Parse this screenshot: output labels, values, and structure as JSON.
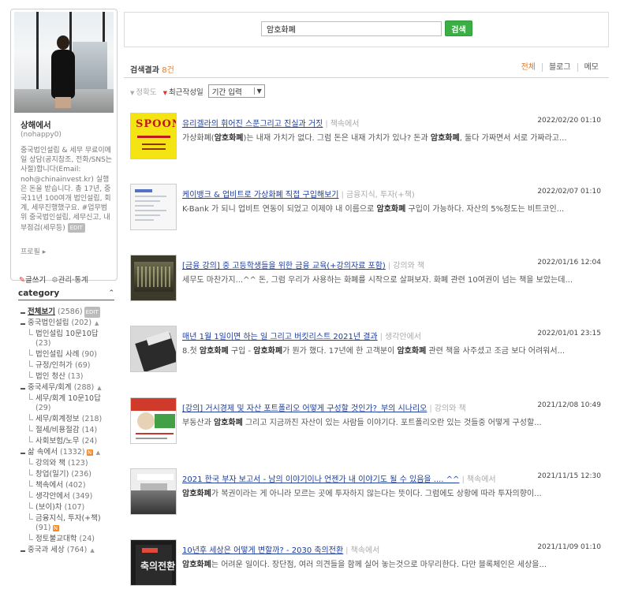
{
  "profile": {
    "blog_name": "상해에서",
    "blog_id": "(nohappy0)",
    "description": "중국법인설립 & 세무 무료이메일 상담(공지참조, 전화/SNS는 사절)합니다(Email: noh@chinainvest.kr) 실행은 돈을 받습니다.  총 17년, 중국11년 100여개 법인설립, 회계, 세무진행했구요.  #업무범위 중국법인설립, 세무신고, 내부점검(세무등)",
    "more_badge": "EDIT",
    "profile_link": "프로필",
    "write_label": "글쓰기",
    "manage_label": "관리·통계"
  },
  "category": {
    "title": "category",
    "toggle": "⌃",
    "items": [
      {
        "level": 0,
        "name": "전체보기",
        "count": "(2586)",
        "badge": "EDIT",
        "all": true
      },
      {
        "level": 0,
        "name": "중국법인설립",
        "count": "(202)",
        "caret": "▲"
      },
      {
        "level": 1,
        "name": "법인설립 10문10답",
        "count": "(23)",
        "multiline": true
      },
      {
        "level": 1,
        "name": "법인설립 사례",
        "count": "(90)"
      },
      {
        "level": 1,
        "name": "규정/인허가",
        "count": "(69)"
      },
      {
        "level": 1,
        "name": "법인 청산",
        "count": "(13)"
      },
      {
        "level": 0,
        "name": "중국세무/회계",
        "count": "(288)",
        "caret": "▲"
      },
      {
        "level": 1,
        "name": "세무/회계 10문10답",
        "count": "(29)",
        "multiline": true
      },
      {
        "level": 1,
        "name": "세무/회계정보",
        "count": "(218)"
      },
      {
        "level": 1,
        "name": "절세/비용절감",
        "count": "(14)"
      },
      {
        "level": 1,
        "name": "사회보험/노무",
        "count": "(24)"
      },
      {
        "level": 0,
        "name": "삶 속에서",
        "count": "(1332)",
        "new": "N",
        "caret": "▲"
      },
      {
        "level": 1,
        "name": "강의와 책",
        "count": "(123)"
      },
      {
        "level": 1,
        "name": "창업(일기)",
        "count": "(236)"
      },
      {
        "level": 1,
        "name": "책속에서",
        "count": "(402)"
      },
      {
        "level": 1,
        "name": "생각안에서",
        "count": "(349)"
      },
      {
        "level": 1,
        "name": "(보이)차",
        "count": "(107)"
      },
      {
        "level": 1,
        "name": "금융지식, 투자(+책)",
        "count": "(91)",
        "new": "N",
        "multiline": true
      },
      {
        "level": 1,
        "name": "정토불교대학",
        "count": "(24)"
      },
      {
        "level": 0,
        "name": "중국과 세상",
        "count": "(764)",
        "caret": "▲"
      }
    ]
  },
  "search": {
    "query": "암호화폐",
    "button_label": "검색"
  },
  "results_header": {
    "label": "검색결과",
    "count": "8건",
    "tabs": [
      {
        "label": "전체",
        "active": true
      },
      {
        "label": "블로그",
        "active": false
      },
      {
        "label": "메모",
        "active": false
      }
    ]
  },
  "sort": {
    "accuracy": "정확도",
    "recent": "최근작성일",
    "period_value": "기간 입력"
  },
  "results": [
    {
      "title": "유리겔라의 휘어진 스푼그리고 진실과 거짓",
      "category": "책속에서",
      "date": "2022/02/20 01:10",
      "excerpt": "가상화폐(암호화폐)는 내재 가치가 없다. 그럼 돈은 내재 가치가 있나? 돈과 암호화폐, 둘다 가짜면서 서로 가짜라고...",
      "thumb": "spoon-book-cover",
      "thumb_text": "SPOON"
    },
    {
      "title": "케이뱅크 & 업비트로 가상화폐 직접 구입해보기",
      "category": "금융지식, 투자(+책)",
      "date": "2022/02/07 01:10",
      "excerpt": "K-Bank 가 되니 업비트 연동이 되었고 이제야 내 이름으로 암호화폐 구입이 가능하다. 자산의 5%정도는 비트코인...",
      "thumb": "app-screenshot"
    },
    {
      "title": "[금융 강의] 중 고등학생들을 위한 금융 교육(+강의자료 포함)",
      "category": "강의와 책",
      "date": "2022/01/16 12:04",
      "excerpt": "세무도 마찬가지...^^ 돈, 그럼 우리가 사용하는 화폐를 시작으로 살펴보자. 화폐 관련 10여권이 넘는 책을 보았는데...",
      "thumb": "lecture-screen"
    },
    {
      "title": "매년 1월 1일이면 하는 일 그리고 버킷리스트 2021년 결과",
      "category": "생각안에서",
      "date": "2022/01/01 23:15",
      "excerpt": "8.첫 암호화폐 구입 - 암호화폐가 뭔가 했다. 17년에 한 고객분이 암호화폐 관련 책을 사주셨고 조금 보다 어려워서...",
      "thumb": "book-photo"
    },
    {
      "title": "[강의] 거시경제 및 자산 포트폴리오 어떻게 구성할 것인가?_부의 시나리오",
      "category": "강의와 책",
      "date": "2021/12/08 10:49",
      "excerpt": "부동산과 암호화폐 그리고 지금까진 자산이 있는 사람들 이야기다. 포트폴리오란 있는 것들중 어떻게 구성할...",
      "thumb": "lecture-poster"
    },
    {
      "title": "2021 한국 부자 보고서 - 남의 이야기이나 언젠가 내 이야기도 될 수 있음을 .... ^^",
      "category": "책속에서",
      "date": "2021/11/15 12:30",
      "excerpt": "암호화폐가 복권이라는 게 아니라 모르는 곳에 투자하지 않는다는 뜻이다. 그럼에도 상황에 따라 투자의향이...",
      "thumb": "report-seminar"
    },
    {
      "title": "10년후 세상은 어떻게 변할까? - 2030 축의전환",
      "category": "책속에서",
      "date": "2021/11/09 01:10",
      "excerpt": "암호화폐는 어려운 일이다. 장단점, 여러 의견들을 함께 실어 놓는것으로 마무리한다. 다만 블록체인은 세상을...",
      "thumb": "book-2030",
      "thumb_text": "축의전환"
    }
  ]
}
